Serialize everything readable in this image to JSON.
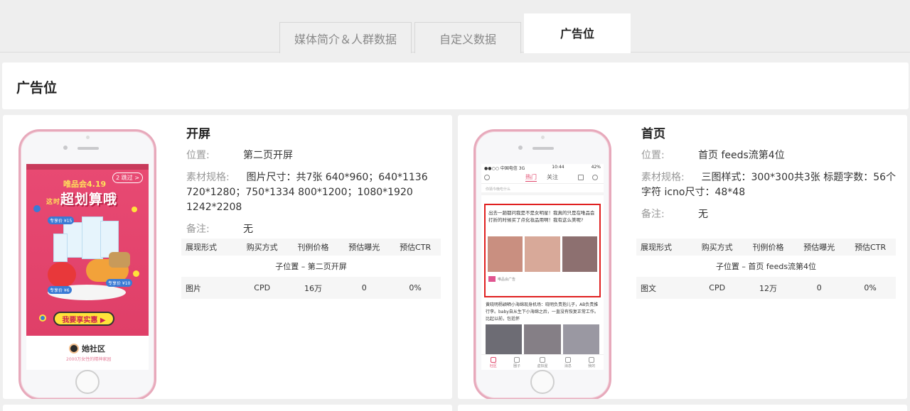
{
  "tabs": [
    {
      "label": "媒体简介＆人群数据"
    },
    {
      "label": "自定义数据"
    },
    {
      "label": "广告位"
    }
  ],
  "section_title": "广告位",
  "table_headers": [
    "展现形式",
    "购买方式",
    "刊例价格",
    "预估曝光",
    "预估CTR"
  ],
  "cards": [
    {
      "title": "开屏",
      "position_label": "位置:",
      "position": "第二页开屏",
      "spec_label": "素材规格:",
      "spec": "图片尺寸：共7张 640*960；640*1136 720*1280；750*1334 800*1200；1080*1920 1242*2208",
      "note_label": "备注:",
      "note": "无",
      "sub_position": "子位置 – 第二页开屏",
      "row": [
        "图片",
        "CPD",
        "16万",
        "0",
        "0%"
      ],
      "mock": {
        "skip": "2 跳过 >",
        "brand": "唯品会4.19",
        "headline": "超划算哦",
        "headline_prefix": "这时",
        "cta": "我要享实惠 ▶",
        "logo": "她社区",
        "slogan": "2000万女性的精神家园",
        "tag1": "专享价 ¥15",
        "tag2": "专享价 ¥6",
        "tag3": "专享价 ¥10"
      }
    },
    {
      "title": "首页",
      "position_label": "位置:",
      "position": "首页 feeds流第4位",
      "spec_label": "素材规格:",
      "spec": "三图样式：300*300共3张 标题字数：56个字符 icno尺寸：48*48",
      "note_label": "备注:",
      "note": "无",
      "sub_position": "子位置 – 首页 feeds流第4位",
      "row": [
        "图文",
        "CPD",
        "12万",
        "0",
        "0%"
      ],
      "mock": {
        "carrier": "●●○○ 中国电信 3G",
        "time": "10:44",
        "battery": "42%",
        "tab_hot": "热门",
        "tab_follow": "关注",
        "user_row": "你猜今晚吃什么",
        "ad_text": "出去一趟都问我是不是女明星！我真的只是在唯品会打折的时候买了点化妆品用啊！我有这么美呢?",
        "ad_footer": "唯品会广告",
        "post_text": "黄晓明杨颖晒小海绵现身机场：晓明负责抱儿子，AB负责推行李。baby自从生下小海绵之后，一直没有恢复正常工作。比起以前，包括怀",
        "nav": [
          "社区",
          "圈子",
          "虚拟屋",
          "消息",
          "我的"
        ]
      }
    }
  ]
}
